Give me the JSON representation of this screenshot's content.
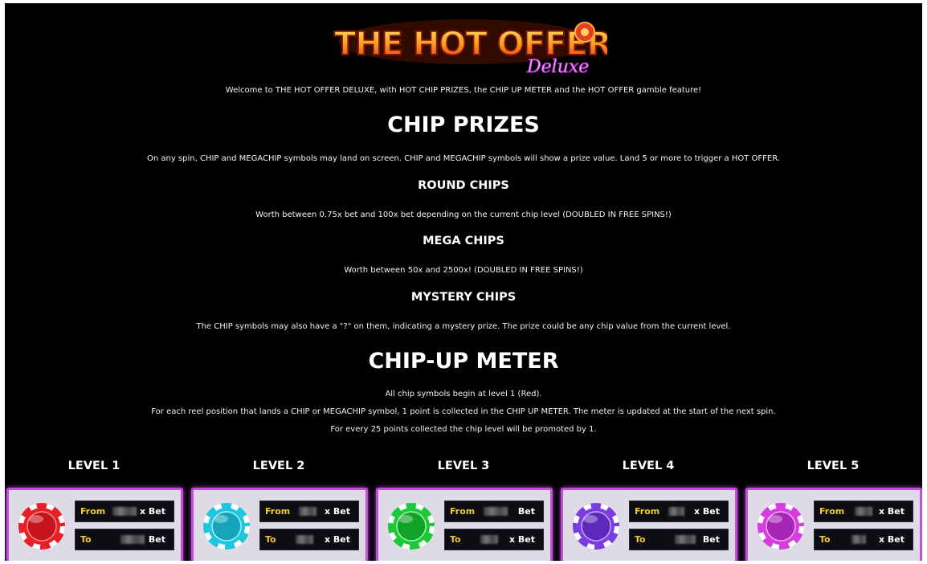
{
  "logo": {
    "main_text": "THE HOT OFFER",
    "sub_text": "Deluxe"
  },
  "intro": "Welcome to THE HOT OFFER DELUXE, with HOT CHIP PRIZES, the CHIP UP METER and the HOT OFFER gamble feature!",
  "chip_prizes": {
    "heading": "CHIP PRIZES",
    "description": "On any spin, CHIP and MEGACHIP symbols may land on screen. CHIP and MEGACHIP symbols will show a prize value. Land 5 or more to trigger a HOT OFFER.",
    "round_chips": {
      "heading": "ROUND CHIPS",
      "text": "Worth between 0.75x bet and 100x bet depending on the current chip level (DOUBLED IN FREE SPINS!)"
    },
    "mega_chips": {
      "heading": "MEGA CHIPS",
      "text": "Worth between 50x and 2500x! (DOUBLED IN FREE SPINS!)"
    },
    "mystery_chips": {
      "heading": "MYSTERY CHIPS",
      "text": "The CHIP symbols may also have a \"?\" on them, indicating a mystery prize. The prize could be any chip value from the current level."
    }
  },
  "chip_up_meter": {
    "heading": "CHIP-UP METER",
    "line1": "All chip symbols begin at level 1 (Red).",
    "line2": "For each reel position that lands a CHIP or MEGACHIP symbol, 1 point is collected in the CHIP UP METER. The meter is updated at the start of the next spin.",
    "line3": "For every 25 points collected the chip level will be promoted by 1."
  },
  "levels": [
    {
      "title": "LEVEL 1",
      "from_label": "From",
      "from_value": "x Bet",
      "to_label": "To",
      "to_value": "Bet",
      "color": "#e8202a"
    },
    {
      "title": "LEVEL 2",
      "from_label": "From",
      "from_value": "x Bet",
      "to_label": "To",
      "to_value": "x Bet",
      "color": "#21c6de"
    },
    {
      "title": "LEVEL 3",
      "from_label": "From",
      "from_value": "Bet",
      "to_label": "To",
      "to_value": "x Bet",
      "color": "#1ec83a"
    },
    {
      "title": "LEVEL 4",
      "from_label": "From",
      "from_value": "x Bet",
      "to_label": "To",
      "to_value": "Bet",
      "color": "#7a3ee0"
    },
    {
      "title": "LEVEL 5",
      "from_label": "From",
      "from_value": "x Bet",
      "to_label": "To",
      "to_value": "x Bet",
      "color": "#d43ee0"
    }
  ]
}
